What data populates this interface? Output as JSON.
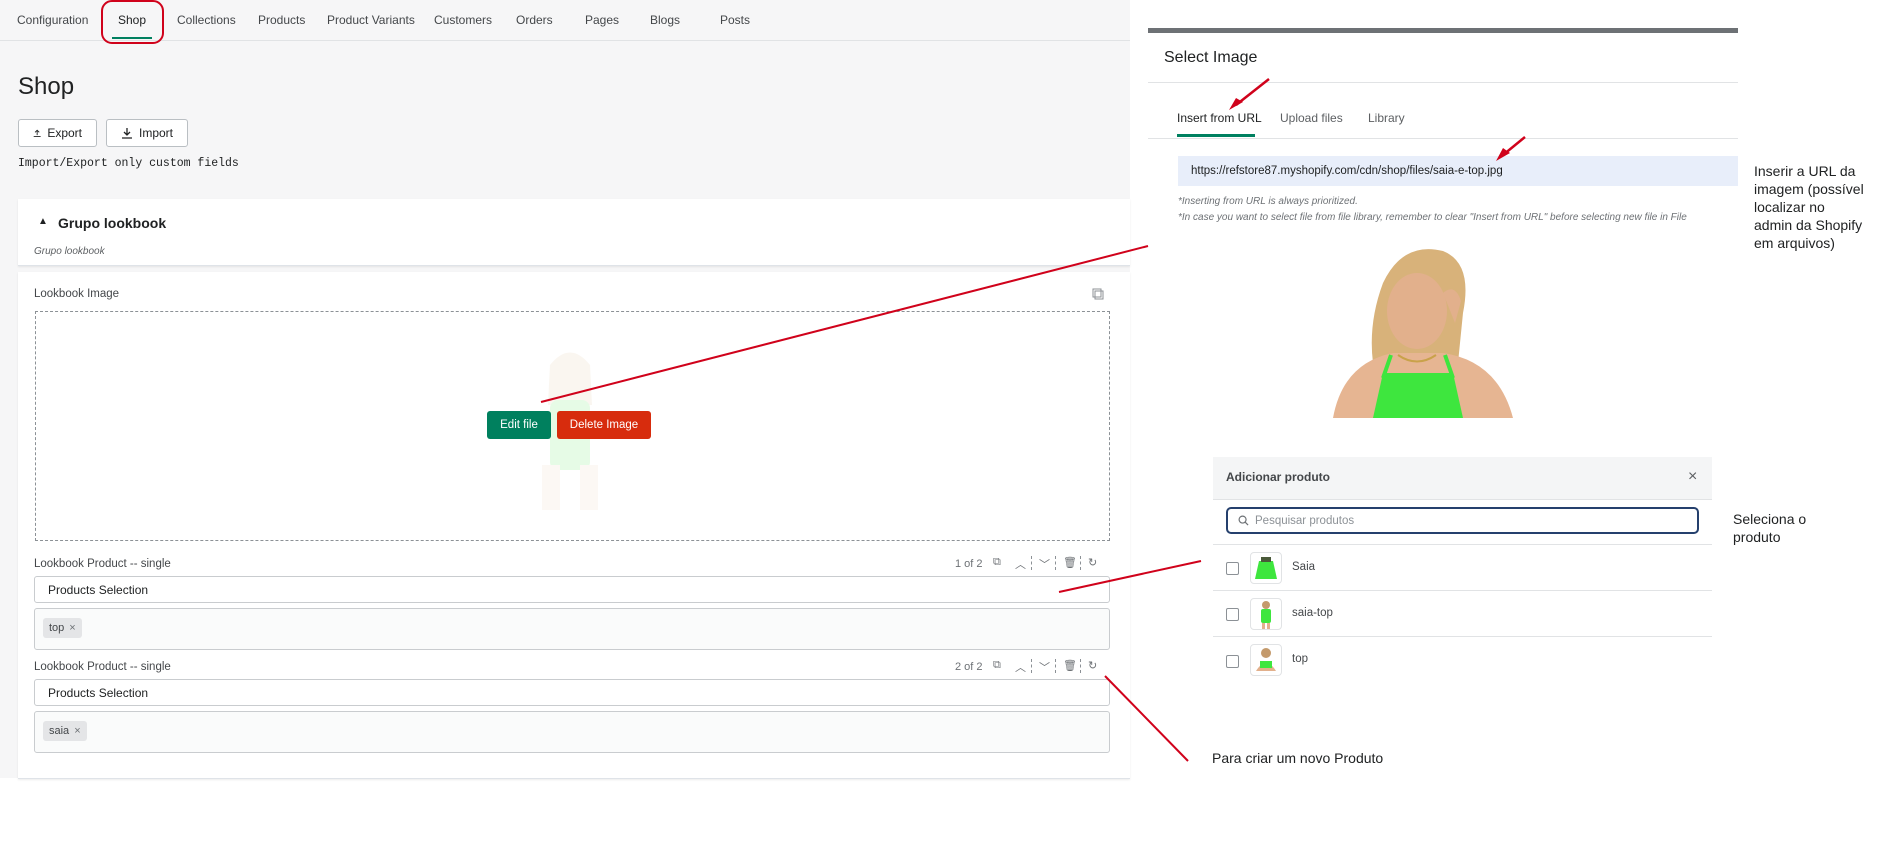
{
  "nav": {
    "tabs": [
      "Configuration",
      "Shop",
      "Collections",
      "Products",
      "Product Variants",
      "Customers",
      "Orders",
      "Pages",
      "Blogs",
      "Posts"
    ],
    "active": "Shop"
  },
  "page": {
    "title": "Shop",
    "export_label": "Export",
    "import_label": "Import",
    "note": "Import/Export only custom fields"
  },
  "group": {
    "title": "Grupo lookbook",
    "subtitle": "Grupo lookbook"
  },
  "lookbook_image": {
    "label": "Lookbook Image",
    "edit_label": "Edit file",
    "delete_label": "Delete Image"
  },
  "products": [
    {
      "label": "Lookbook Product -- single",
      "counter": "1 of 2",
      "select": "Products Selection",
      "tag": "top"
    },
    {
      "label": "Lookbook Product -- single",
      "counter": "2 of 2",
      "select": "Products Selection",
      "tag": "saia"
    }
  ],
  "select_image": {
    "title": "Select Image",
    "tabs": [
      "Insert from URL",
      "Upload files",
      "Library"
    ],
    "url_value": "https://refstore87.myshopify.com/cdn/shop/files/saia-e-top.jpg",
    "hint1": "*Inserting from URL is always prioritized.",
    "hint2": "*In case you want to select file from file library, remember to clear \"Insert from URL\" before selecting new file in File"
  },
  "add_product": {
    "title": "Adicionar produto",
    "search_placeholder": "Pesquisar produtos",
    "items": [
      "Saia",
      "saia-top",
      "top"
    ]
  },
  "annotations": {
    "url": "Inserir a URL da imagem (possível localizar no admin da Shopify em arquivos)",
    "select": "Seleciona o produto",
    "create": "Para criar um novo Produto"
  },
  "colors": {
    "accent": "#008060",
    "danger": "#d72c0d",
    "annotation_red": "#d0021b",
    "product_green": "#39e639"
  },
  "icons": [
    "export-icon",
    "import-icon",
    "caret-up-icon",
    "copy-icon",
    "chevron-up-icon",
    "chevron-down-icon",
    "trash-icon",
    "refresh-icon",
    "search-icon",
    "close-icon"
  ]
}
